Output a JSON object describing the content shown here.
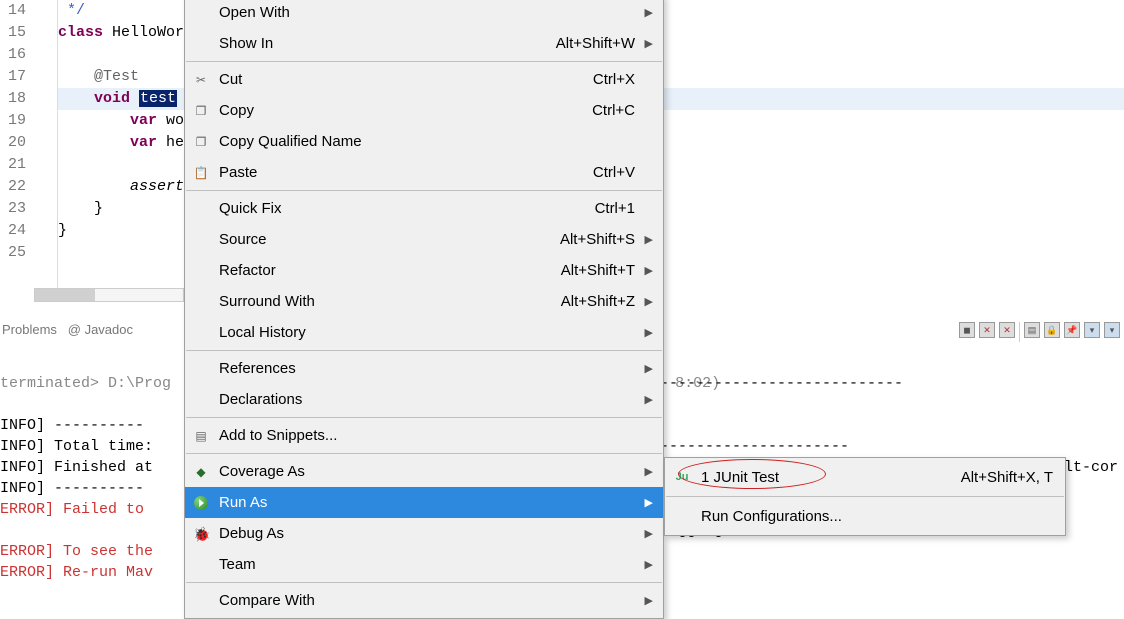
{
  "editor": {
    "lines": [
      {
        "num": "14",
        "html": "<span class='comment'> */</span>"
      },
      {
        "num": "15",
        "html": "<span class='kw'>class</span> HelloWor"
      },
      {
        "num": "16",
        "html": ""
      },
      {
        "num": "17",
        "html": "    <span class='ann'>@Test</span>"
      },
      {
        "num": "18",
        "html": "    <span class='kw'>void</span> <span class='sel-text'>test</span>",
        "highlight": true
      },
      {
        "num": "19",
        "html": "        <span class='kw'>var</span> wo"
      },
      {
        "num": "20",
        "html": "        <span class='kw'>var</span> he"
      },
      {
        "num": "21",
        "html": ""
      },
      {
        "num": "22",
        "html": "        <span style='font-style:italic'>assert</span>"
      },
      {
        "num": "23",
        "html": "    }"
      },
      {
        "num": "24",
        "html": "}"
      },
      {
        "num": "25",
        "html": ""
      }
    ]
  },
  "bottom_tabs": {
    "problems": "Problems",
    "javadoc": "Javadoc"
  },
  "console": {
    "status": "terminated> D:\\Prog",
    "status_right": "8:02)",
    "lines": [
      {
        "type": "info",
        "text": "INFO] ----------"
      },
      {
        "type": "info",
        "text": "INFO] Total time:"
      },
      {
        "type": "info",
        "text": "INFO] Finished at"
      },
      {
        "type": "info",
        "text": "INFO] ----------"
      },
      {
        "type": "error",
        "text": "ERROR] Failed to "
      },
      {
        "type": "error",
        "text": ""
      },
      {
        "type": "error",
        "text": "ERROR] To see the"
      },
      {
        "type": "error",
        "text": "ERROR] Re-run Mav"
      }
    ],
    "dashes_a": "---------------------------",
    "dashes_b": "---------------------",
    "frag_a": "lt-cor",
    "frag_b": "logging."
  },
  "context_menu": {
    "items": [
      {
        "label": "Open With",
        "shortcut": "",
        "arrow": true,
        "sep_after": false
      },
      {
        "label": "Show In",
        "shortcut": "Alt+Shift+W",
        "arrow": true,
        "sep_after": true
      },
      {
        "label": "Cut",
        "shortcut": "Ctrl+X",
        "icon": "cut"
      },
      {
        "label": "Copy",
        "shortcut": "Ctrl+C",
        "icon": "copy"
      },
      {
        "label": "Copy Qualified Name",
        "shortcut": "",
        "icon": "copyq"
      },
      {
        "label": "Paste",
        "shortcut": "Ctrl+V",
        "icon": "paste",
        "sep_after": true
      },
      {
        "label": "Quick Fix",
        "shortcut": "Ctrl+1"
      },
      {
        "label": "Source",
        "shortcut": "Alt+Shift+S",
        "arrow": true
      },
      {
        "label": "Refactor",
        "shortcut": "Alt+Shift+T",
        "arrow": true
      },
      {
        "label": "Surround With",
        "shortcut": "Alt+Shift+Z",
        "arrow": true
      },
      {
        "label": "Local History",
        "shortcut": "",
        "arrow": true,
        "sep_after": true
      },
      {
        "label": "References",
        "shortcut": "",
        "arrow": true
      },
      {
        "label": "Declarations",
        "shortcut": "",
        "arrow": true,
        "sep_after": true
      },
      {
        "label": "Add to Snippets...",
        "shortcut": "",
        "icon": "snip",
        "sep_after": true
      },
      {
        "label": "Coverage As",
        "shortcut": "",
        "arrow": true,
        "icon": "cov"
      },
      {
        "label": "Run As",
        "shortcut": "",
        "arrow": true,
        "icon": "run",
        "selected": true
      },
      {
        "label": "Debug As",
        "shortcut": "",
        "arrow": true,
        "icon": "bug"
      },
      {
        "label": "Team",
        "shortcut": "",
        "arrow": true,
        "sep_after": true
      },
      {
        "label": "Compare With",
        "shortcut": "",
        "arrow": true
      }
    ]
  },
  "submenu": {
    "junit_icon": "Ju",
    "junit_label": "1 JUnit Test",
    "junit_shortcut": "Alt+Shift+X, T",
    "run_config": "Run Configurations..."
  }
}
